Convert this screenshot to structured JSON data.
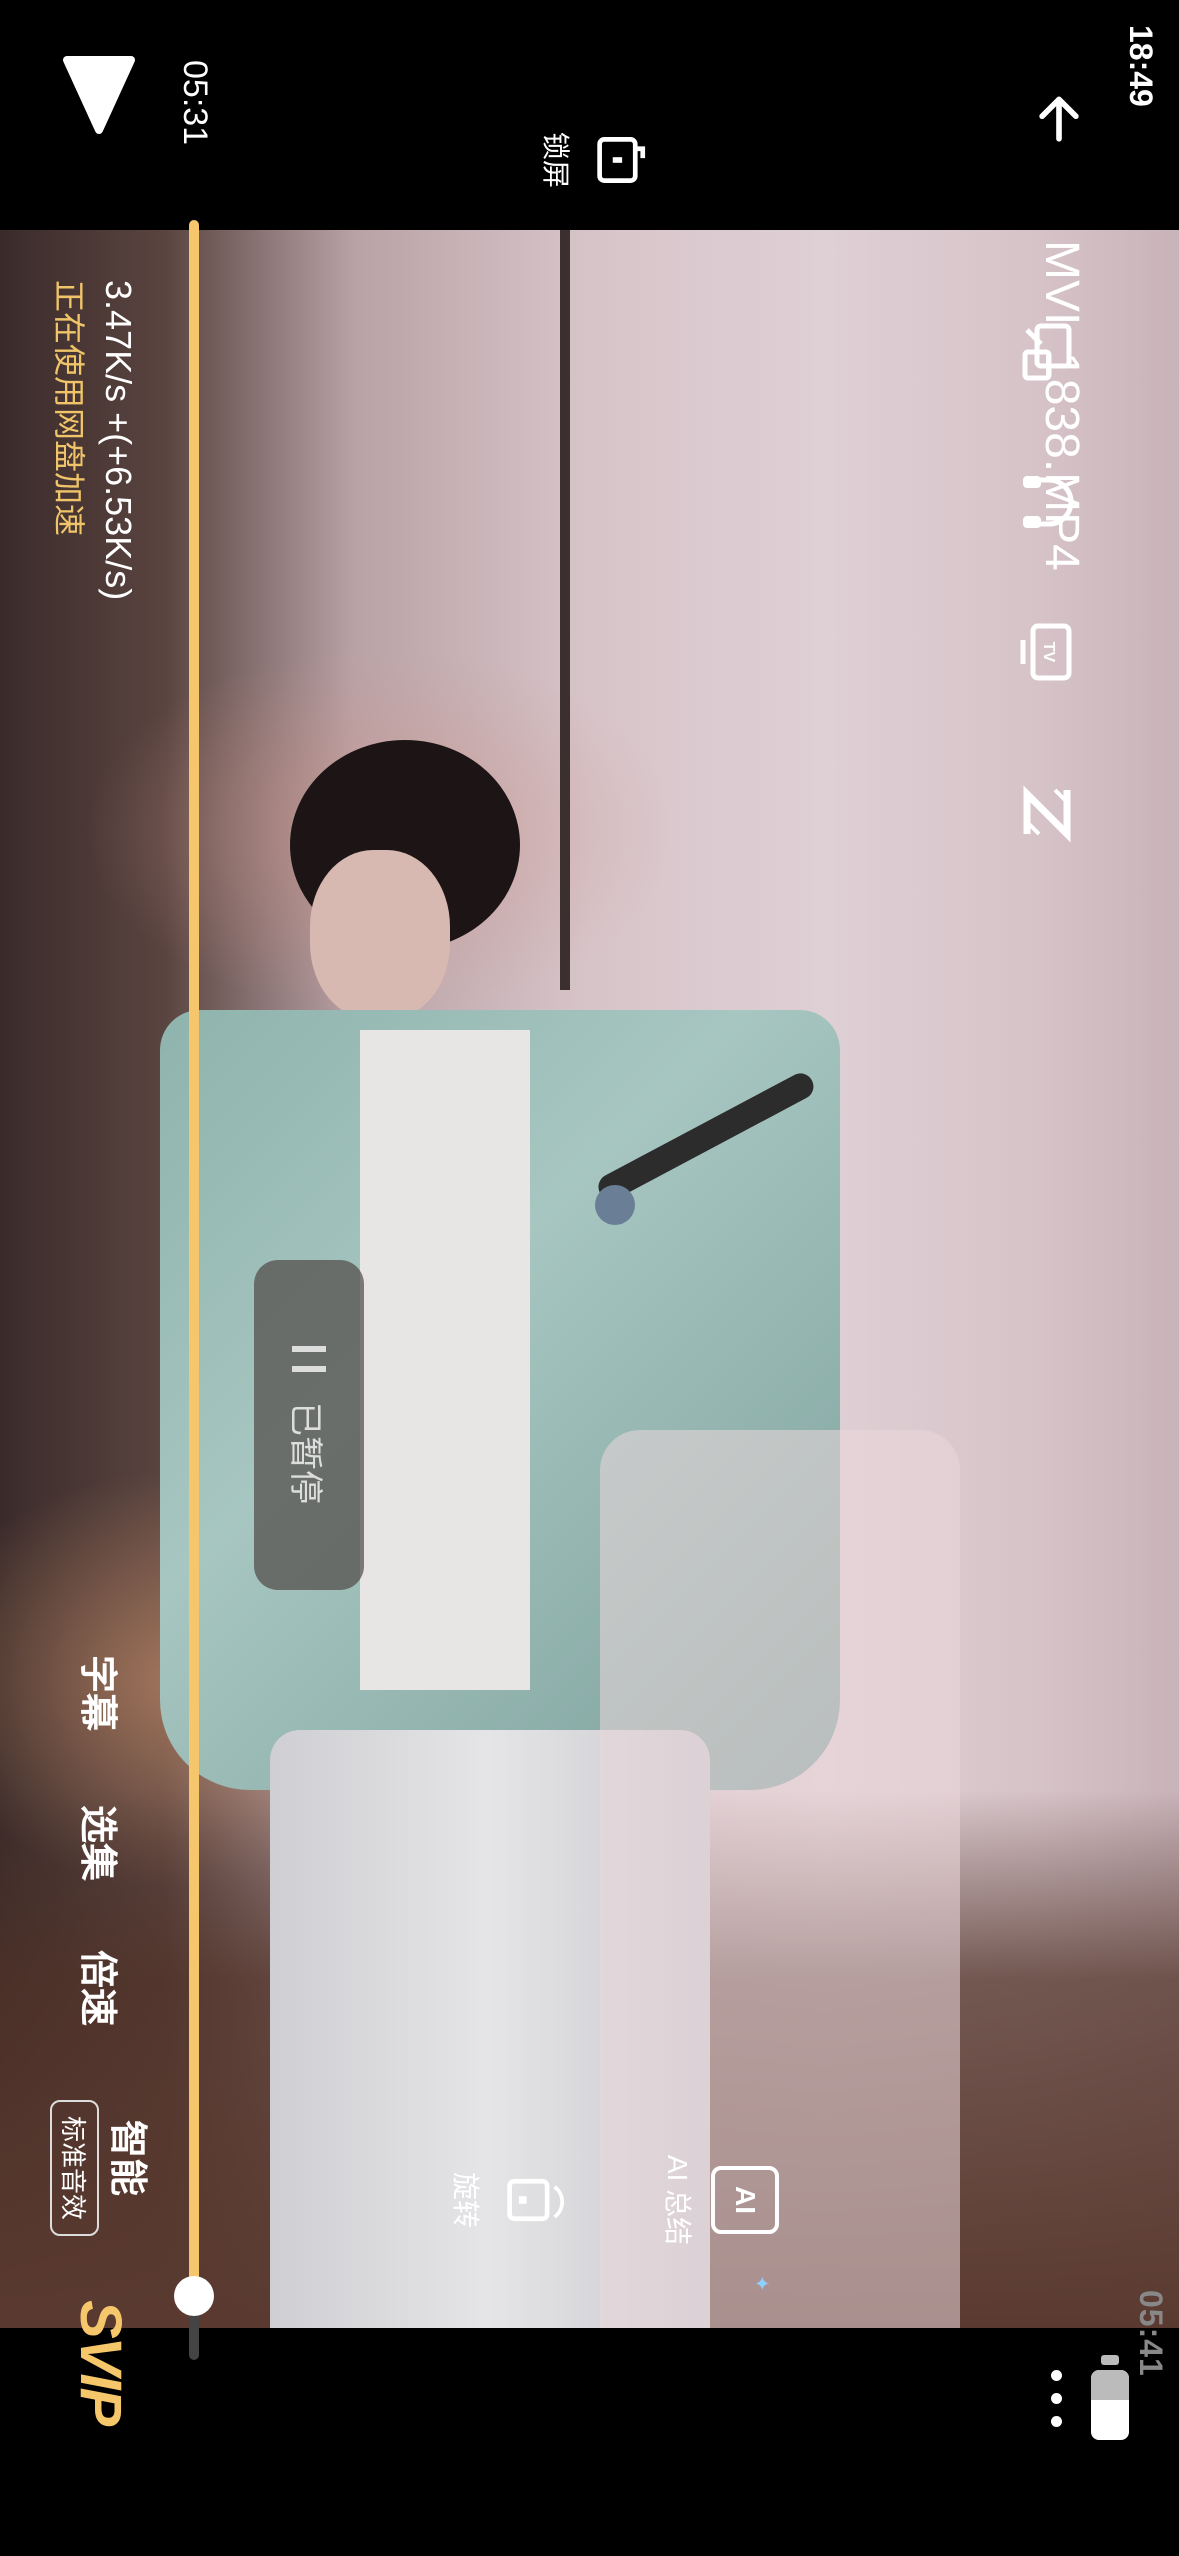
{
  "status": {
    "time": "18:49"
  },
  "player": {
    "title": "MVI_1838.MP4",
    "current_time": "05:31",
    "total_time": "05:41",
    "progress": 0.97,
    "paused_label": "已暂停",
    "speed": "3.47K/s +(+6.53K/s)",
    "accel": "正在使用网盘加速",
    "ai_label": "AI 总结",
    "ai_icon_text": "AI",
    "rotate_label": "旋转",
    "lock_label": "锁屏",
    "controls": {
      "subtitle": "字幕",
      "episode": "选集",
      "speed": "倍速",
      "smart": "智能",
      "sound": "标准音效"
    },
    "badge": "SVIP"
  },
  "colors": {
    "accent": "#f5c66b",
    "accel": "#f0c56a"
  },
  "icons": [
    "back-arrow-icon",
    "more-icon",
    "battery-icon",
    "pip-icon",
    "headphones-icon",
    "tv-cast-icon",
    "z-logo-icon",
    "lock-icon",
    "rotate-icon",
    "ai-summary-icon",
    "pause-icon",
    "play-icon"
  ]
}
